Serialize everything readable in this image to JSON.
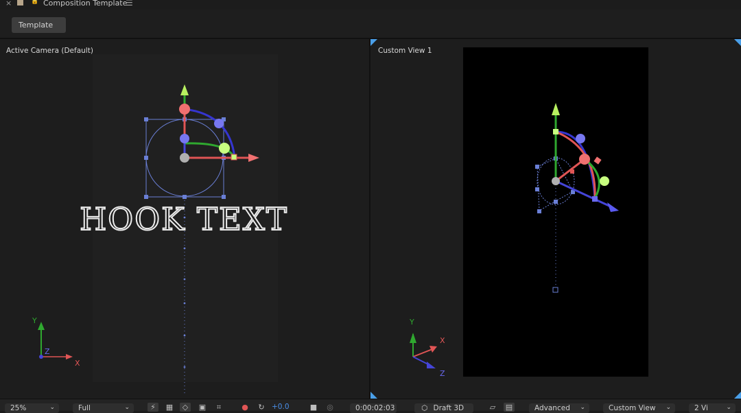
{
  "tab": {
    "title": "Composition Template",
    "close": "×",
    "lock": "🔒",
    "menu": "☰"
  },
  "toolbar": {
    "template_label": "Template"
  },
  "left_view": {
    "label": "Active Camera (Default)",
    "text_layer": "HOOK TEXT",
    "axis_y": "Y",
    "axis_z": "Z",
    "axis_x": "X"
  },
  "right_view": {
    "label": "Custom View 1",
    "axis_y": "Y",
    "axis_x": "X",
    "axis_z": "Z"
  },
  "bottom": {
    "zoom": "25%",
    "resolution": "Full",
    "exposure": "+0.0",
    "timecode": "0:00:02:03",
    "renderer": "Draft 3D",
    "grid_mode": "Advanced",
    "view": "Custom View",
    "layout": "2 Vi"
  },
  "colors": {
    "x_axis": "#e05555",
    "y_axis": "#3cb43c",
    "z_axis": "#4545d8",
    "selection": "#6a7fd6",
    "handle_green": "#c8ff80"
  }
}
